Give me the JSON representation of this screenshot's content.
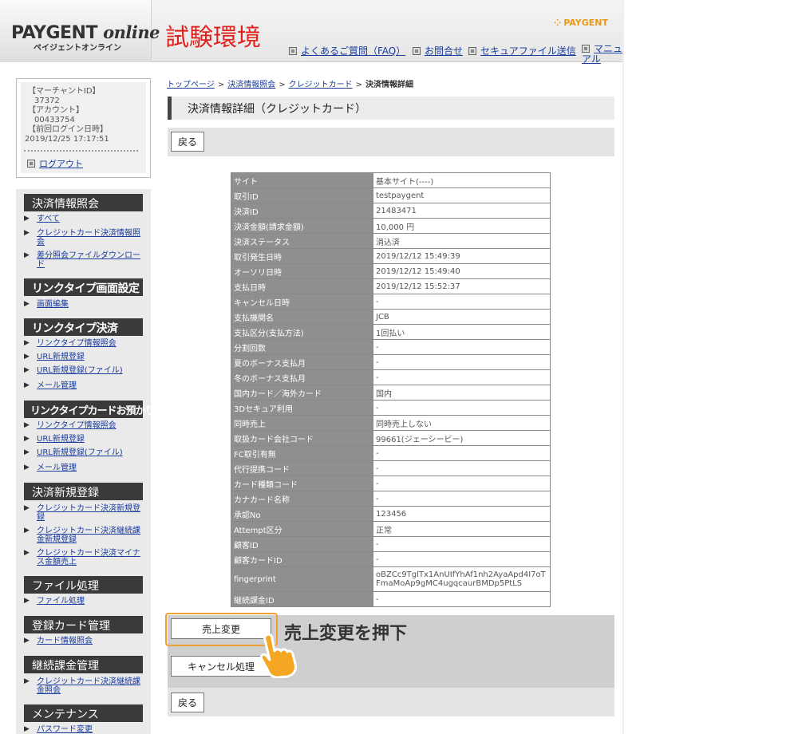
{
  "header": {
    "logo_main": "PAYGENT",
    "logo_online": "online",
    "logo_sub": "ペイジェントオンライン",
    "environment": "試験環境",
    "brand": "PAYGENT",
    "nav": [
      {
        "label": "よくあるご質問（FAQ）"
      },
      {
        "label": "お問合せ"
      },
      {
        "label": "セキュアファイル送信"
      },
      {
        "label": "マニュアル"
      }
    ]
  },
  "account": {
    "merchant_id_label": "【マーチャントID】",
    "merchant_id": "37372",
    "account_label": "【アカウント】",
    "account": "00433754",
    "last_login_label": "【前回ログイン日時】",
    "last_login": "2019/12/25 17:17:51",
    "logout": "ログアウト"
  },
  "sidebar": {
    "sections": [
      {
        "title": "決済情報照会",
        "items": [
          "すべて",
          "クレジットカード決済情報照会",
          "差分照会ファイルダウンロード"
        ]
      },
      {
        "title": "リンクタイプ画面設定",
        "items": [
          "画面編集"
        ]
      },
      {
        "title": "リンクタイプ決済",
        "items": [
          "リンクタイプ情報照会",
          "URL新規登録",
          "URL新規登録(ファイル)",
          "メール管理"
        ]
      },
      {
        "title": "リンクタイプカードお預かり",
        "items": [
          "リンクタイプ情報照会",
          "URL新規登録",
          "URL新規登録(ファイル)",
          "メール管理"
        ]
      },
      {
        "title": "決済新規登録",
        "items": [
          "クレジットカード決済新規登録",
          "クレジットカード決済継続課金新規登録",
          "クレジットカード決済マイナス金額売上"
        ]
      },
      {
        "title": "ファイル処理",
        "items": [
          "ファイル処理"
        ]
      },
      {
        "title": "登録カード管理",
        "items": [
          "カード情報照会"
        ]
      },
      {
        "title": "継続課金管理",
        "items": [
          "クレジットカード決済継続課金照会"
        ]
      },
      {
        "title": "メンテナンス",
        "items": [
          "パスワード変更"
        ]
      }
    ]
  },
  "breadcrumb": [
    "トップページ",
    "決済情報照会",
    "クレジットカード",
    "決済情報詳細"
  ],
  "page_title": "決済情報詳細（クレジットカード）",
  "buttons": {
    "back": "戻る",
    "sales_change": "売上変更",
    "cancel": "キャンセル処理"
  },
  "callout": "売上変更を押下",
  "details": [
    {
      "label": "サイト",
      "value": "基本サイト(----)"
    },
    {
      "label": "取引ID",
      "value": "testpaygent"
    },
    {
      "label": "決済ID",
      "value": "21483471"
    },
    {
      "label": "決済金額(請求金額)",
      "value": "10,000 円"
    },
    {
      "label": "決済ステータス",
      "value": "消込済"
    },
    {
      "label": "取引発生日時",
      "value": "2019/12/12 15:49:39"
    },
    {
      "label": "オーソリ日時",
      "value": "2019/12/12 15:49:40"
    },
    {
      "label": "支払日時",
      "value": "2019/12/12 15:52:37"
    },
    {
      "label": "キャンセル日時",
      "value": "-"
    },
    {
      "label": "支払機関名",
      "value": "JCB"
    },
    {
      "label": "支払区分(支払方法)",
      "value": "1回払い"
    },
    {
      "label": "分割回数",
      "value": "-"
    },
    {
      "label": "夏のボーナス支払月",
      "value": "-"
    },
    {
      "label": "冬のボーナス支払月",
      "value": "-"
    },
    {
      "label": "国内カード／海外カード",
      "value": "国内"
    },
    {
      "label": "3Dセキュア利用",
      "value": "-"
    },
    {
      "label": "同時売上",
      "value": "同時売上しない"
    },
    {
      "label": "取扱カード会社コード",
      "value": "99661(ジェーシービー)"
    },
    {
      "label": "FC取引有無",
      "value": "-"
    },
    {
      "label": "代行提携コード",
      "value": "-"
    },
    {
      "label": "カード種類コード",
      "value": "-"
    },
    {
      "label": "カナカード名称",
      "value": "-"
    },
    {
      "label": "承認No",
      "value": "123456"
    },
    {
      "label": "Attempt区分",
      "value": "正常"
    },
    {
      "label": "顧客ID",
      "value": "-"
    },
    {
      "label": "顧客カードID",
      "value": "-"
    },
    {
      "label": "fingerprint",
      "value": "oBZCc9TglTx1AnUIfYhAf1nh2AyaApd4I7oTFmaMoAp9gMC4ugqcaurBMDp5PtLS"
    },
    {
      "label": "継続課金ID",
      "value": "-"
    }
  ]
}
